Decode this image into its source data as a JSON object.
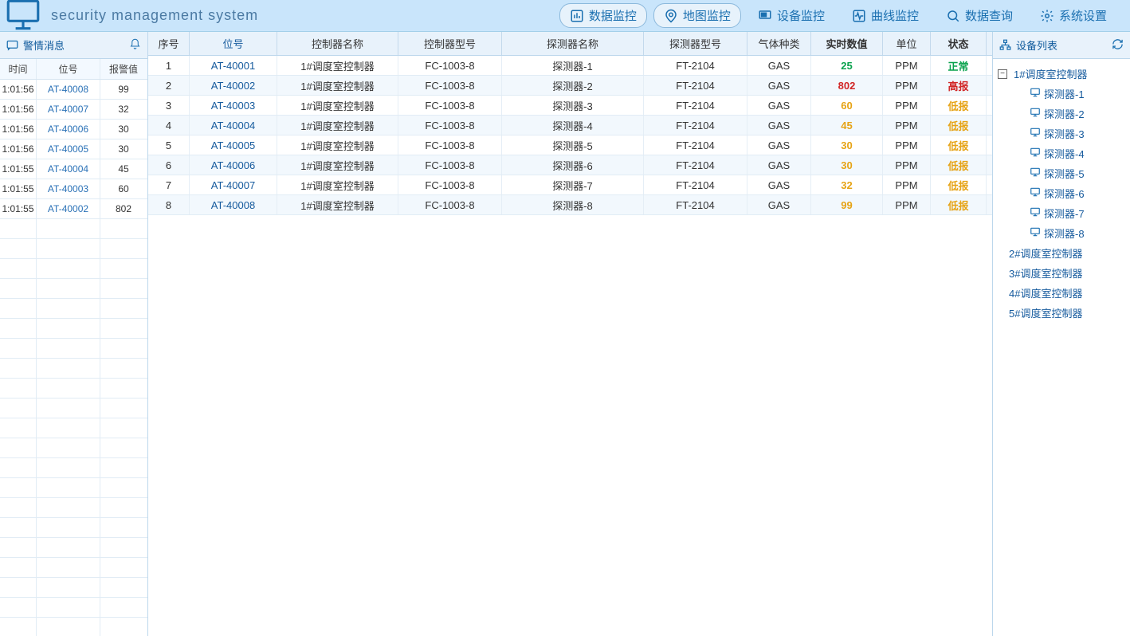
{
  "header": {
    "title": "security management system",
    "nav": [
      {
        "label": "数据监控",
        "icon": "bar-chart",
        "active": true
      },
      {
        "label": "地图监控",
        "icon": "map",
        "active": true
      },
      {
        "label": "设备监控",
        "icon": "device",
        "active": false
      },
      {
        "label": "曲线监控",
        "icon": "pulse",
        "active": false
      },
      {
        "label": "数据查询",
        "icon": "search",
        "active": false
      },
      {
        "label": "系统设置",
        "icon": "gear",
        "active": false
      }
    ]
  },
  "alarm_panel": {
    "title": "警情消息",
    "columns": [
      "时间",
      "位号",
      "报警值"
    ],
    "rows": [
      {
        "time": "1:01:56",
        "tag": "AT-40008",
        "val": "99"
      },
      {
        "time": "1:01:56",
        "tag": "AT-40007",
        "val": "32"
      },
      {
        "time": "1:01:56",
        "tag": "AT-40006",
        "val": "30"
      },
      {
        "time": "1:01:56",
        "tag": "AT-40005",
        "val": "30"
      },
      {
        "time": "1:01:55",
        "tag": "AT-40004",
        "val": "45"
      },
      {
        "time": "1:01:55",
        "tag": "AT-40003",
        "val": "60"
      },
      {
        "time": "1:01:55",
        "tag": "AT-40002",
        "val": "802"
      }
    ],
    "empty_rows": 21
  },
  "main_table": {
    "columns": [
      "序号",
      "位号",
      "控制器名称",
      "控制器型号",
      "探测器名称",
      "探测器型号",
      "气体种类",
      "实时数值",
      "单位",
      "状态"
    ],
    "rows": [
      {
        "i": "1",
        "tag": "AT-40001",
        "cname": "1#调度室控制器",
        "cmodel": "FC-1003-8",
        "dname": "探测器-1",
        "dmodel": "FT-2104",
        "gas": "GAS",
        "val": "25",
        "unit": "PPM",
        "status": "正常",
        "stcls": "st-normal",
        "valcls": "st-normal"
      },
      {
        "i": "2",
        "tag": "AT-40002",
        "cname": "1#调度室控制器",
        "cmodel": "FC-1003-8",
        "dname": "探测器-2",
        "dmodel": "FT-2104",
        "gas": "GAS",
        "val": "802",
        "unit": "PPM",
        "status": "高报",
        "stcls": "st-high",
        "valcls": "st-high"
      },
      {
        "i": "3",
        "tag": "AT-40003",
        "cname": "1#调度室控制器",
        "cmodel": "FC-1003-8",
        "dname": "探测器-3",
        "dmodel": "FT-2104",
        "gas": "GAS",
        "val": "60",
        "unit": "PPM",
        "status": "低报",
        "stcls": "st-low",
        "valcls": "st-low"
      },
      {
        "i": "4",
        "tag": "AT-40004",
        "cname": "1#调度室控制器",
        "cmodel": "FC-1003-8",
        "dname": "探测器-4",
        "dmodel": "FT-2104",
        "gas": "GAS",
        "val": "45",
        "unit": "PPM",
        "status": "低报",
        "stcls": "st-low",
        "valcls": "st-low"
      },
      {
        "i": "5",
        "tag": "AT-40005",
        "cname": "1#调度室控制器",
        "cmodel": "FC-1003-8",
        "dname": "探测器-5",
        "dmodel": "FT-2104",
        "gas": "GAS",
        "val": "30",
        "unit": "PPM",
        "status": "低报",
        "stcls": "st-low",
        "valcls": "st-low"
      },
      {
        "i": "6",
        "tag": "AT-40006",
        "cname": "1#调度室控制器",
        "cmodel": "FC-1003-8",
        "dname": "探测器-6",
        "dmodel": "FT-2104",
        "gas": "GAS",
        "val": "30",
        "unit": "PPM",
        "status": "低报",
        "stcls": "st-low",
        "valcls": "st-low"
      },
      {
        "i": "7",
        "tag": "AT-40007",
        "cname": "1#调度室控制器",
        "cmodel": "FC-1003-8",
        "dname": "探测器-7",
        "dmodel": "FT-2104",
        "gas": "GAS",
        "val": "32",
        "unit": "PPM",
        "status": "低报",
        "stcls": "st-low",
        "valcls": "st-low"
      },
      {
        "i": "8",
        "tag": "AT-40008",
        "cname": "1#调度室控制器",
        "cmodel": "FC-1003-8",
        "dname": "探测器-8",
        "dmodel": "FT-2104",
        "gas": "GAS",
        "val": "99",
        "unit": "PPM",
        "status": "低报",
        "stcls": "st-low",
        "valcls": "st-low"
      }
    ]
  },
  "device_panel": {
    "title": "设备列表",
    "tree": {
      "root": "1#调度室控制器",
      "leaves": [
        "探测器-1",
        "探测器-2",
        "探测器-3",
        "探测器-4",
        "探测器-5",
        "探测器-6",
        "探测器-7",
        "探测器-8"
      ],
      "controllers": [
        "2#调度室控制器",
        "3#调度室控制器",
        "4#调度室控制器",
        "5#调度室控制器"
      ]
    }
  }
}
